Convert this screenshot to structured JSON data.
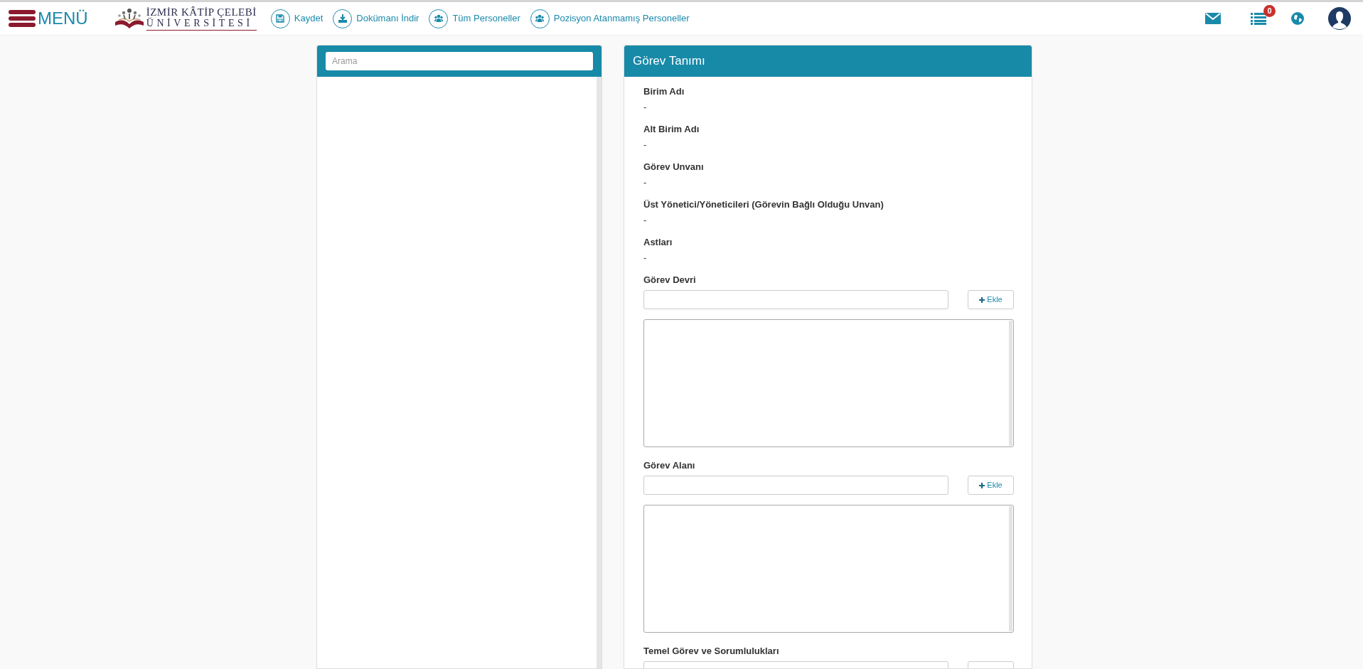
{
  "header": {
    "menu_label": "MENÜ",
    "logo": {
      "line_1": "İZMİR KÂTİP ÇELEBİ",
      "line_2": "ÜNİVERSİTESİ"
    },
    "toolbar": [
      {
        "label": "Kaydet",
        "kind": "save"
      },
      {
        "label": "Dokümanı İndir",
        "kind": "download"
      },
      {
        "label": "Tüm Personeller",
        "kind": "users"
      },
      {
        "label": "Pozisyon Atanmamış Personeller",
        "kind": "users"
      }
    ],
    "notification_count": "0"
  },
  "left_panel": {
    "search": {
      "placeholder": "Arama"
    }
  },
  "right_panel": {
    "title": "Görev Tanımı",
    "info_fields": [
      {
        "label": "Birim Adı",
        "value": "-"
      },
      {
        "label": "Alt Birim Adı",
        "value": "-"
      },
      {
        "label": "Görev Unvanı",
        "value": "-"
      },
      {
        "label": "Üst Yönetici/Yöneticileri (Görevin Bağlı Olduğu Unvan)",
        "value": "-"
      },
      {
        "label": "Astları",
        "value": "-"
      }
    ],
    "list_sections": [
      {
        "label": "Görev Devri",
        "button": "Ekle"
      },
      {
        "label": "Görev Alanı",
        "button": "Ekle"
      },
      {
        "label": "Temel Görev ve Sorumlulukları"
      }
    ]
  }
}
